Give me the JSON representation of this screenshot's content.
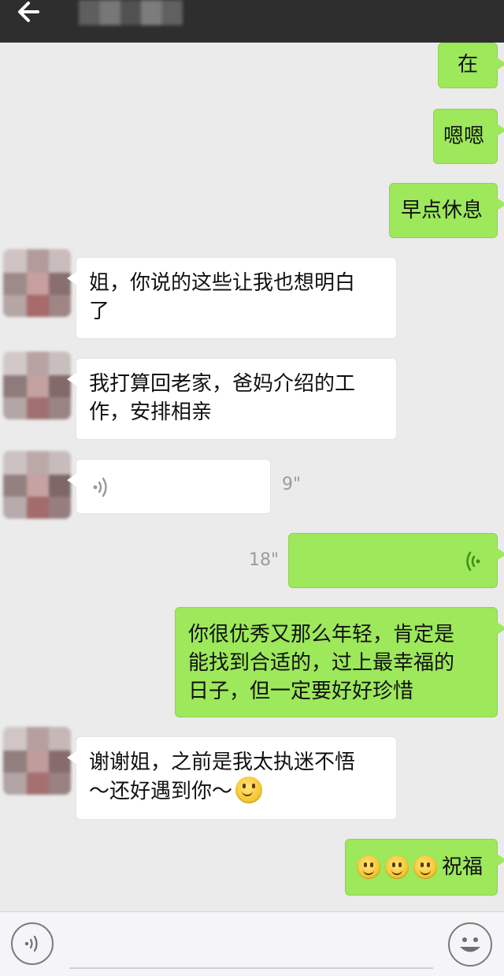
{
  "header": {
    "back_icon": "back-arrow-icon"
  },
  "messages": {
    "m1": "在",
    "m2": "嗯嗯",
    "m3": "早点休息",
    "m4_line1": "姐，你说的这些让我也想明白",
    "m4_line2": "了",
    "m5_line1": "我打算回老家，爸妈介绍的工",
    "m5_line2": "作，安排相亲",
    "m6_duration": "9\"",
    "m7_duration": "18\"",
    "m8_line1": "你很优秀又那么年轻，肯定是",
    "m8_line2": "能找到合适的，过上最幸福的",
    "m8_line3": "日子，但一定要好好珍惜",
    "m9_line1": "谢谢姐，之前是我太执迷不悟",
    "m9_line2": "～还好遇到你～",
    "m10_text": "祝福"
  },
  "input_bar": {
    "voice_icon": "voice-toggle-icon",
    "emoji_icon": "emoji-icon"
  },
  "colors": {
    "my_bubble": "#9de85b",
    "their_bubble": "#ffffff",
    "header": "#2e2e2e",
    "background": "#ebebeb"
  }
}
